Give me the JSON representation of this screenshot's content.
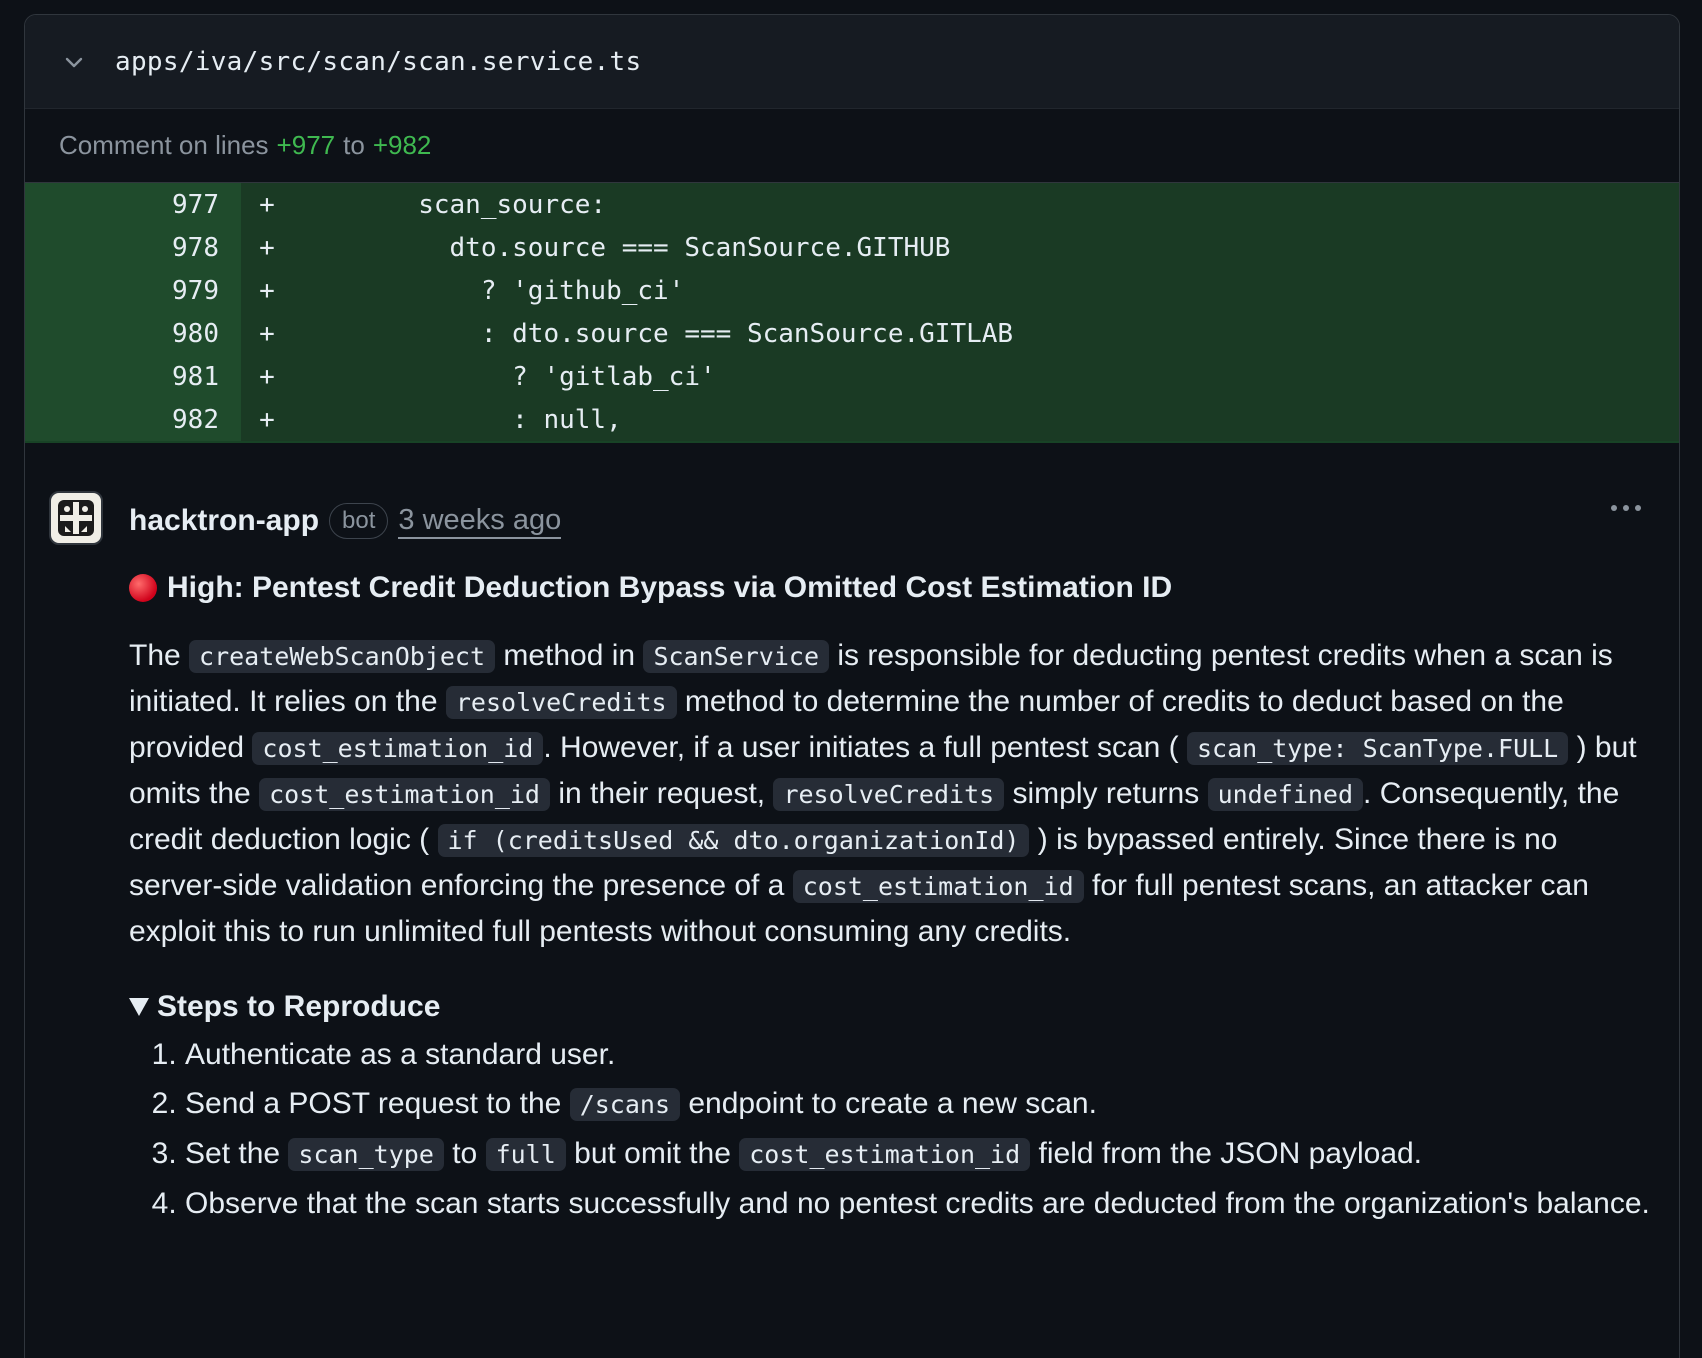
{
  "file": {
    "path": "apps/iva/src/scan/scan.service.ts"
  },
  "comment_range": {
    "prefix": "Comment on lines",
    "start": "+977",
    "middle": "to",
    "end": "+982"
  },
  "diff": {
    "lines": [
      {
        "num": "977",
        "sign": "+",
        "code": "        scan_source:"
      },
      {
        "num": "978",
        "sign": "+",
        "code": "          dto.source === ScanSource.GITHUB"
      },
      {
        "num": "979",
        "sign": "+",
        "code": "            ? 'github_ci'"
      },
      {
        "num": "980",
        "sign": "+",
        "code": "            : dto.source === ScanSource.GITLAB"
      },
      {
        "num": "981",
        "sign": "+",
        "code": "              ? 'gitlab_ci'"
      },
      {
        "num": "982",
        "sign": "+",
        "code": "              : null,"
      }
    ]
  },
  "comment": {
    "author": "hacktron-app",
    "badge": "bot",
    "time": "3 weeks ago",
    "title": "High: Pentest Credit Deduction Bypass via Omitted Cost Estimation ID",
    "paragraph": {
      "t1": "The ",
      "c1": "createWebScanObject",
      "t2": " method in ",
      "c2": "ScanService",
      "t3": " is responsible for deducting pentest credits when a scan is initiated. It relies on the ",
      "c3": "resolveCredits",
      "t4": " method to determine the number of credits to deduct based on the provided ",
      "c4": "cost_estimation_id",
      "t5": ". However, if a user initiates a full pentest scan ( ",
      "c5": "scan_type: ScanType.FULL",
      "t6": " ) but omits the ",
      "c6": "cost_estimation_id",
      "t7": " in their request, ",
      "c7": "resolveCredits",
      "t8": " simply returns ",
      "c8": "undefined",
      "t9": ". Consequently, the credit deduction logic ( ",
      "c9": "if (creditsUsed && dto.organizationId)",
      "t10": " ) is bypassed entirely. Since there is no server-side validation enforcing the presence of a ",
      "c10": "cost_estimation_id",
      "t11": " for full pentest scans, an attacker can exploit this to run unlimited full pentests without consuming any credits."
    },
    "steps_title": "Steps to Reproduce",
    "steps": {
      "s1": "Authenticate as a standard user.",
      "s2a": "Send a POST request to the ",
      "s2c": "/scans",
      "s2b": " endpoint to create a new scan.",
      "s3a": "Set the ",
      "s3c1": "scan_type",
      "s3b": " to ",
      "s3c2": "full",
      "s3d": " but omit the ",
      "s3c3": "cost_estimation_id",
      "s3e": " field from the JSON payload.",
      "s4": "Observe that the scan starts successfully and no pentest credits are deducted from the organization's balance."
    }
  },
  "colors": {
    "background": "#0d1117",
    "diff_added": "#1a3a24",
    "diff_gutter": "#1f4b2c",
    "accent_green": "#3fb950",
    "severity_red": "#d0021b"
  },
  "icons": {
    "collapse": "chevron-down-icon",
    "more": "kebab-horizontal-icon",
    "severity": "red-circle-icon",
    "disclosure": "triangle-down-icon"
  }
}
